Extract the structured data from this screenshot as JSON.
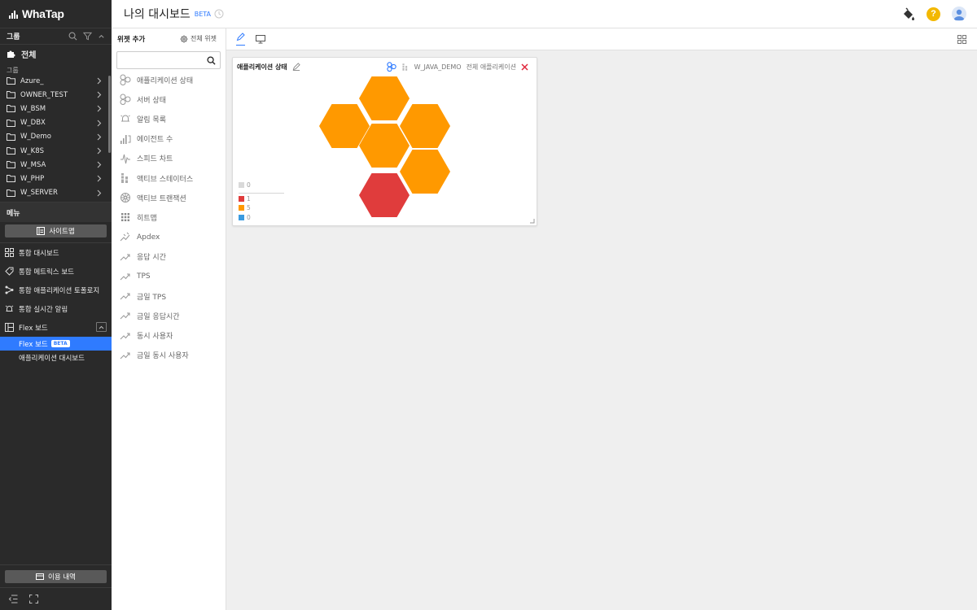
{
  "app": {
    "logo_text": "WhaTap"
  },
  "header": {
    "title": "나의 대시보드",
    "beta": "BETA"
  },
  "sidebar": {
    "group_header": "그룹",
    "all_label": "전체",
    "group_label": "그룹",
    "groups": [
      "Azure_",
      "OWNER_TEST",
      "W_BSM",
      "W_DBX",
      "W_Demo",
      "W_K8S",
      "W_MSA",
      "W_PHP",
      "W_SERVER"
    ],
    "menu_header": "메뉴",
    "sitemap_label": "사이트맵",
    "menu_items": [
      "통합 대시보드",
      "통합 메트릭스 보드",
      "통합 애플리케이션 토폴로지",
      "통합 실시간 알림",
      "Flex 보드"
    ],
    "flex_sub_items": [
      {
        "label": "Flex 보드",
        "badge": "BETA"
      },
      {
        "label": "애플리케이션 대시보드",
        "badge": ""
      }
    ],
    "usage_label": "이용 내역"
  },
  "palette": {
    "title": "위젯 추가",
    "all_widgets_label": "전체 위젯",
    "search_placeholder": "",
    "widgets": [
      {
        "label": "애플리케이션 상태",
        "icon": "hexagon-cluster-icon"
      },
      {
        "label": "서버 상태",
        "icon": "hexagon-cluster-icon"
      },
      {
        "label": "알림 목록",
        "icon": "bell-icon"
      },
      {
        "label": "에이전트 수",
        "icon": "bar-chart-icon"
      },
      {
        "label": "스피드 차트",
        "icon": "speed-chart-icon"
      },
      {
        "label": "액티브 스테이터스",
        "icon": "stacked-bars-icon"
      },
      {
        "label": "액티브 트랜잭션",
        "icon": "wheel-icon"
      },
      {
        "label": "히트맵",
        "icon": "grid-dots-icon"
      },
      {
        "label": "Apdex",
        "icon": "apdex-icon"
      },
      {
        "label": "응답 시간",
        "icon": "trend-line-icon"
      },
      {
        "label": "TPS",
        "icon": "trend-line-icon"
      },
      {
        "label": "금일 TPS",
        "icon": "trend-line-icon"
      },
      {
        "label": "금일 응답시간",
        "icon": "trend-line-icon"
      },
      {
        "label": "동시 사용자",
        "icon": "trend-line-icon"
      },
      {
        "label": "금일 동시 사용자",
        "icon": "trend-line-icon"
      }
    ]
  },
  "widget": {
    "title": "애플리케이션 상태",
    "project": "W_JAVA_DEMO",
    "scope": "전체 애플리케이션",
    "legend": [
      {
        "value": "0",
        "color": "#d9d9d9"
      },
      {
        "value": "1",
        "color": "#e03c3c"
      },
      {
        "value": "5",
        "color": "#ff9900"
      },
      {
        "value": "0",
        "color": "#3a9be0"
      }
    ],
    "hexes": [
      {
        "state": "warning",
        "color": "#ff9900"
      },
      {
        "state": "warning",
        "color": "#ff9900"
      },
      {
        "state": "warning",
        "color": "#ff9900"
      },
      {
        "state": "warning",
        "color": "#ff9900"
      },
      {
        "state": "warning",
        "color": "#ff9900"
      },
      {
        "state": "critical",
        "color": "#e03c3c"
      }
    ]
  },
  "colors": {
    "accent": "#2f7bff",
    "sidebar_bg": "#2a2a2a",
    "warning": "#ff9900",
    "critical": "#e03c3c",
    "help": "#f3b800"
  }
}
